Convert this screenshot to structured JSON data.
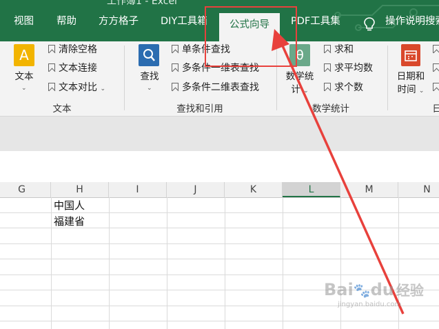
{
  "title_text": "工作簿1 - Excel",
  "tabs": [
    {
      "label": "视图"
    },
    {
      "label": "帮助"
    },
    {
      "label": "方方格子"
    },
    {
      "label": "DIY工具箱"
    },
    {
      "label": "公式向导",
      "active": true
    },
    {
      "label": "PDF工具集"
    }
  ],
  "tell_me": {
    "label": "操作说明搜索",
    "icon": "lightbulb-icon"
  },
  "ribbon": {
    "text_group": {
      "big_button": "文本",
      "items": [
        "清除空格",
        "文本连接",
        "文本对比"
      ],
      "label": "文本"
    },
    "lookup_group": {
      "big_button": "查找",
      "items": [
        "单条件查找",
        "多条件一维表查找",
        "多条件二维表查找"
      ],
      "label": "查找和引用"
    },
    "stats_group": {
      "big_button_line1": "数学统",
      "big_button_line2": "计",
      "items": [
        "求和",
        "求平均数",
        "求个数"
      ],
      "label": "数学统计"
    },
    "date_group": {
      "big_button_line1": "日期和",
      "big_button_line2": "时间",
      "label": "日"
    }
  },
  "columns": [
    "G",
    "H",
    "I",
    "J",
    "K",
    "L",
    "M",
    "N"
  ],
  "selected_column": "L",
  "cells": {
    "h1": "中国人",
    "h2": "福建省"
  },
  "watermark": {
    "brand": "Bai",
    "brand2": "du",
    "suffix": "经验",
    "url": "jingyan.baidu.com"
  },
  "colors": {
    "excel_green": "#217346",
    "annotation_red": "#e8413c",
    "ribbon_bg": "#f3f3f3"
  }
}
